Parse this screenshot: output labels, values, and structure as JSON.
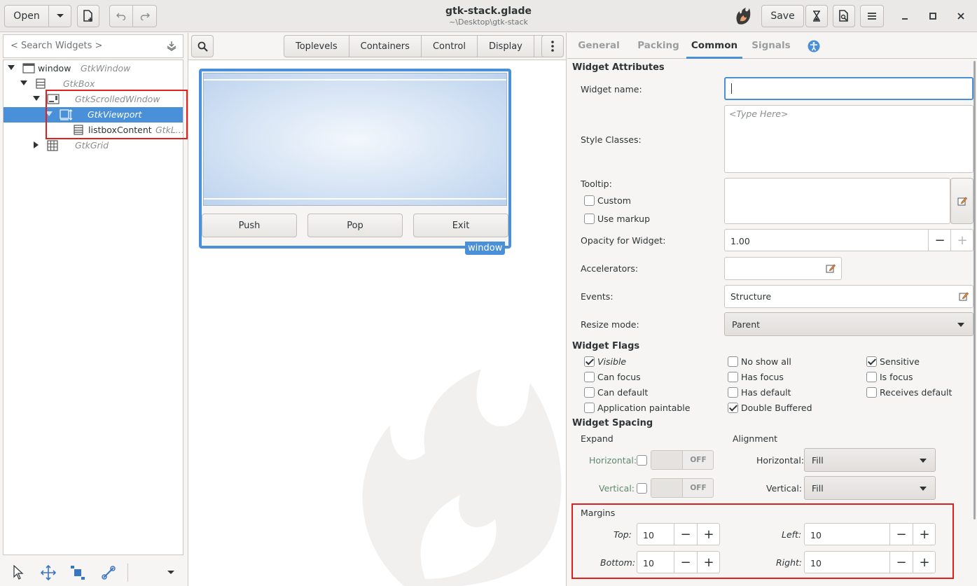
{
  "header": {
    "open_label": "Open",
    "title": "gtk-stack.glade",
    "subtitle": "~\\Desktop\\gtk-stack",
    "save_label": "Save"
  },
  "search": {
    "placeholder": "< Search Widgets >"
  },
  "tree": [
    {
      "label": "window",
      "class": "GtkWindow"
    },
    {
      "label": "",
      "class": "GtkBox"
    },
    {
      "label": "",
      "class": "GtkScrolledWindow"
    },
    {
      "label": "",
      "class": "GtkViewport"
    },
    {
      "label": "listboxContent",
      "class": "GtkL..."
    },
    {
      "label": "",
      "class": "GtkGrid"
    }
  ],
  "palette": {
    "tabs": [
      "Toplevels",
      "Containers",
      "Control",
      "Display"
    ]
  },
  "preview": {
    "buttons": [
      "Push",
      "Pop",
      "Exit"
    ],
    "tag": "window"
  },
  "inspector": {
    "tabs": [
      "General",
      "Packing",
      "Common",
      "Signals"
    ],
    "active_tab": "Common",
    "widget_attributes_heading": "Widget Attributes",
    "widget_name_label": "Widget name:",
    "widget_name_value": "",
    "style_classes_label": "Style Classes:",
    "style_classes_placeholder": "<Type Here>",
    "tooltip_label": "Tooltip:",
    "custom_label": "Custom",
    "use_markup_label": "Use markup",
    "opacity_label": "Opacity for Widget:",
    "opacity_value": "1.00",
    "accelerators_label": "Accelerators:",
    "events_label": "Events:",
    "events_value": "Structure",
    "resize_mode_label": "Resize mode:",
    "resize_mode_value": "Parent",
    "flags_heading": "Widget Flags",
    "flags": [
      {
        "label": "Visible",
        "checked": true
      },
      {
        "label": "No show all",
        "checked": false
      },
      {
        "label": "Sensitive",
        "checked": true
      },
      {
        "label": "Can focus",
        "checked": false
      },
      {
        "label": "Has focus",
        "checked": false
      },
      {
        "label": "Is focus",
        "checked": false
      },
      {
        "label": "Can default",
        "checked": false
      },
      {
        "label": "Has default",
        "checked": false
      },
      {
        "label": "Receives default",
        "checked": false
      },
      {
        "label": "Application paintable",
        "checked": false
      },
      {
        "label": "Double Buffered",
        "checked": true
      }
    ],
    "spacing_heading": "Widget Spacing",
    "expand_label": "Expand",
    "alignment_label": "Alignment",
    "horizontal_label": "Horizontal:",
    "vertical_label": "Vertical:",
    "switch_off": "OFF",
    "halign_value": "Fill",
    "valign_value": "Fill",
    "margins_heading": "Margins",
    "margin_top_label": "Top:",
    "margin_top": "10",
    "margin_left_label": "Left:",
    "margin_left": "10",
    "margin_bottom_label": "Bottom:",
    "margin_bottom": "10",
    "margin_right_label": "Right:",
    "margin_right": "10"
  },
  "colors": {
    "accent": "#4a90d9",
    "highlight_box": "#e0201c"
  }
}
